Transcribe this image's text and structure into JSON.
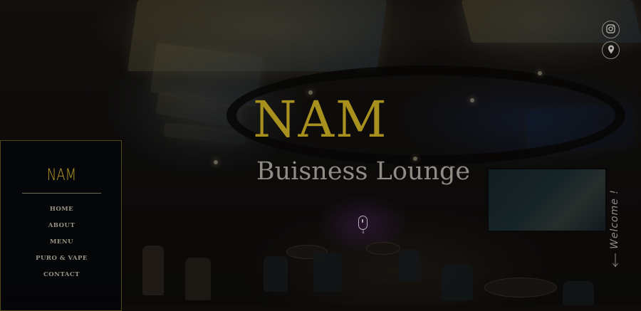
{
  "hero": {
    "title": "NAM",
    "subtitle": "Buisness Lounge"
  },
  "colors": {
    "title_gold": "#a8901e",
    "logo_gold": "#b49a22",
    "subtitle_gray": "#8f8c86",
    "sidebar_bg": "#04050a",
    "sidebar_border": "#4f4716",
    "nav_text": "#9a9385"
  },
  "social": [
    {
      "icon": "instagram-icon"
    },
    {
      "icon": "location-pin-icon"
    }
  ],
  "scroll_indicator": {
    "icon": "mouse-scroll-icon"
  },
  "welcome": {
    "text": "Welcome !",
    "icon": "arrow-down-icon"
  },
  "sidebar": {
    "logo": "NAM",
    "nav": [
      {
        "label": "HOME"
      },
      {
        "label": "ABOUT"
      },
      {
        "label": "MENU"
      },
      {
        "label": "PURO & VAPE"
      },
      {
        "label": "CONTACT"
      }
    ]
  }
}
